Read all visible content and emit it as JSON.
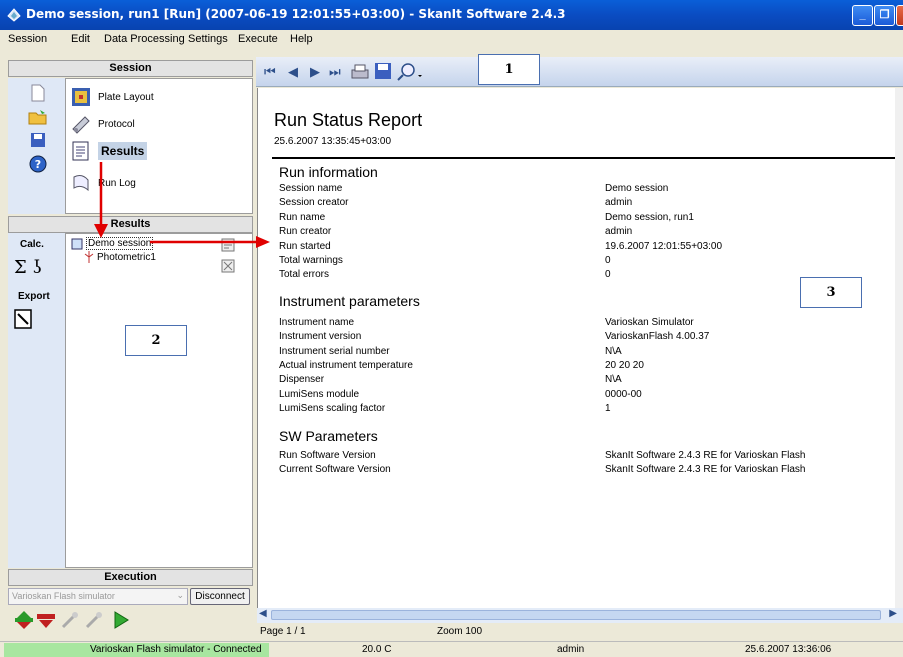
{
  "window": {
    "title": "Demo session, run1 [Run] (2007-06-19 12:01:55+03:00) - SkanIt Software 2.4.3",
    "controls": {
      "minimize": "_",
      "maximize": "❐",
      "close": "X"
    }
  },
  "menu": [
    "Session",
    "Edit",
    "Data Processing",
    "Settings",
    "Execute",
    "Help"
  ],
  "session_panel": {
    "header": "Session",
    "items": [
      {
        "label": "Plate Layout",
        "icon": "plate-layout-icon"
      },
      {
        "label": "Protocol",
        "icon": "protocol-icon"
      },
      {
        "label": "Results",
        "icon": "results-icon",
        "selected": true
      },
      {
        "label": "Run Log",
        "icon": "run-log-icon"
      }
    ],
    "side_icons": [
      "new-icon",
      "open-folder-icon",
      "save-icon",
      "help-icon"
    ]
  },
  "results_panel": {
    "header": "Results",
    "side": {
      "calc": "Calc.",
      "export": "Export"
    },
    "tree": {
      "root": "Demo session",
      "child": "Photometric1"
    }
  },
  "execution_panel": {
    "header": "Execution",
    "instrument_select": "Varioskan Flash simulator",
    "disconnect_button": "Disconnect"
  },
  "callouts": {
    "one": "1",
    "two": "2",
    "three": "3"
  },
  "report": {
    "title": "Run Status Report",
    "date": "25.6.2007 13:35:45+03:00",
    "run_info": {
      "heading": "Run information",
      "rows": [
        [
          "Session name",
          "Demo session"
        ],
        [
          "Session creator",
          "admin"
        ],
        [
          "Run name",
          "Demo session, run1"
        ],
        [
          "Run creator",
          "admin"
        ],
        [
          "Run started",
          "19.6.2007 12:01:55+03:00"
        ],
        [
          "Total warnings",
          "0"
        ],
        [
          "Total errors",
          "0"
        ]
      ]
    },
    "instrument": {
      "heading": "Instrument parameters",
      "rows": [
        [
          "Instrument name",
          "Varioskan Simulator"
        ],
        [
          "Instrument version",
          "VarioskanFlash 4.00.37"
        ],
        [
          "Instrument serial number",
          "N\\A"
        ],
        [
          "Actual instrument temperature",
          "20 20 20"
        ],
        [
          "Dispenser",
          "N\\A"
        ],
        [
          "LumiSens module",
          "0000-00"
        ],
        [
          "LumiSens scaling factor",
          "1"
        ]
      ]
    },
    "sw": {
      "heading": "SW Parameters",
      "rows": [
        [
          "Run Software Version",
          "SkanIt Software 2.4.3 RE for Varioskan Flash"
        ],
        [
          "Current Software Version",
          "SkanIt Software 2.4.3 RE for Varioskan Flash"
        ]
      ]
    }
  },
  "report_footer": {
    "page": "Page 1 / 1",
    "zoom": "Zoom 100"
  },
  "status": {
    "connection": "Varioskan Flash simulator - Connected",
    "temperature": "20.0 C",
    "user": "admin",
    "datetime": "25.6.2007 13:36:06"
  },
  "colors": {
    "titlebar": "#0a4cc2",
    "connected": "#a8e6a0",
    "arrow": "#e00000"
  }
}
